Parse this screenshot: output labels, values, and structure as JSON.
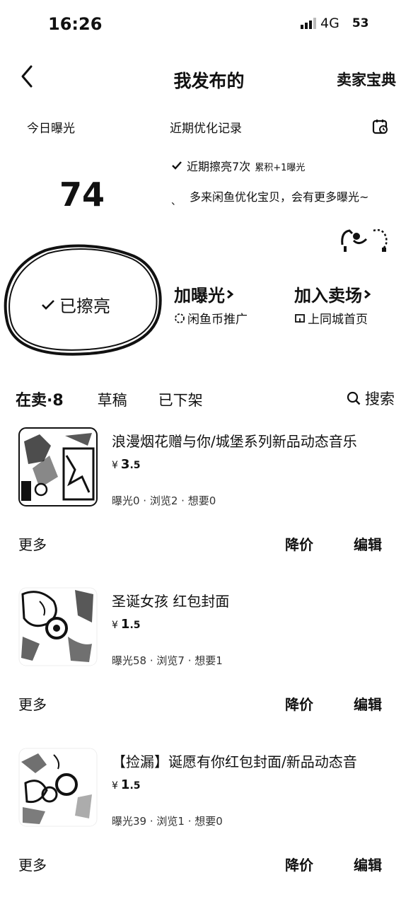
{
  "status_bar": {
    "time": "16:26",
    "network": "4G",
    "battery": "53"
  },
  "nav": {
    "title": "我发布的",
    "right_link": "卖家宝典"
  },
  "summary": {
    "today_label": "今日曝光",
    "today_value": "74",
    "recent_title": "近期优化记录",
    "recent_item": "近期擦亮7次",
    "recent_item_extra": "累积+1曝光",
    "recent_tip": "多来闲鱼优化宝贝，会有更多曝光~"
  },
  "actions": {
    "polished_label": "已擦亮",
    "promo1_title": "加曝光",
    "promo1_sub": "闲鱼币推广",
    "promo2_title": "加入卖场",
    "promo2_sub": "上同城首页"
  },
  "tabs": {
    "selling": "在卖·8",
    "drafts": "草稿",
    "removed": "已下架",
    "search": "搜索"
  },
  "products": [
    {
      "title": "浪漫烟花赠与你/城堡系列新品动态音乐",
      "currency": "¥",
      "price_int": "3",
      "price_dec": ".5",
      "stats": "曝光0 · 浏览2 · 想要0",
      "more": "更多",
      "reduce": "降价",
      "edit": "编辑"
    },
    {
      "title": "圣诞女孩 红包封面",
      "currency": "¥",
      "price_int": "1",
      "price_dec": ".5",
      "stats": "曝光58 · 浏览7 · 想要1",
      "more": "更多",
      "reduce": "降价",
      "edit": "编辑"
    },
    {
      "title": "【捡漏】诞愿有你红包封面/新品动态音",
      "currency": "¥",
      "price_int": "1",
      "price_dec": ".5",
      "stats": "曝光39 · 浏览1 · 想要0",
      "more": "更多",
      "reduce": "降价",
      "edit": "编辑"
    }
  ],
  "icons": {
    "back": "chevron-left-icon",
    "calendar": "calendar-icon",
    "check": "check-icon",
    "search": "search-icon"
  }
}
